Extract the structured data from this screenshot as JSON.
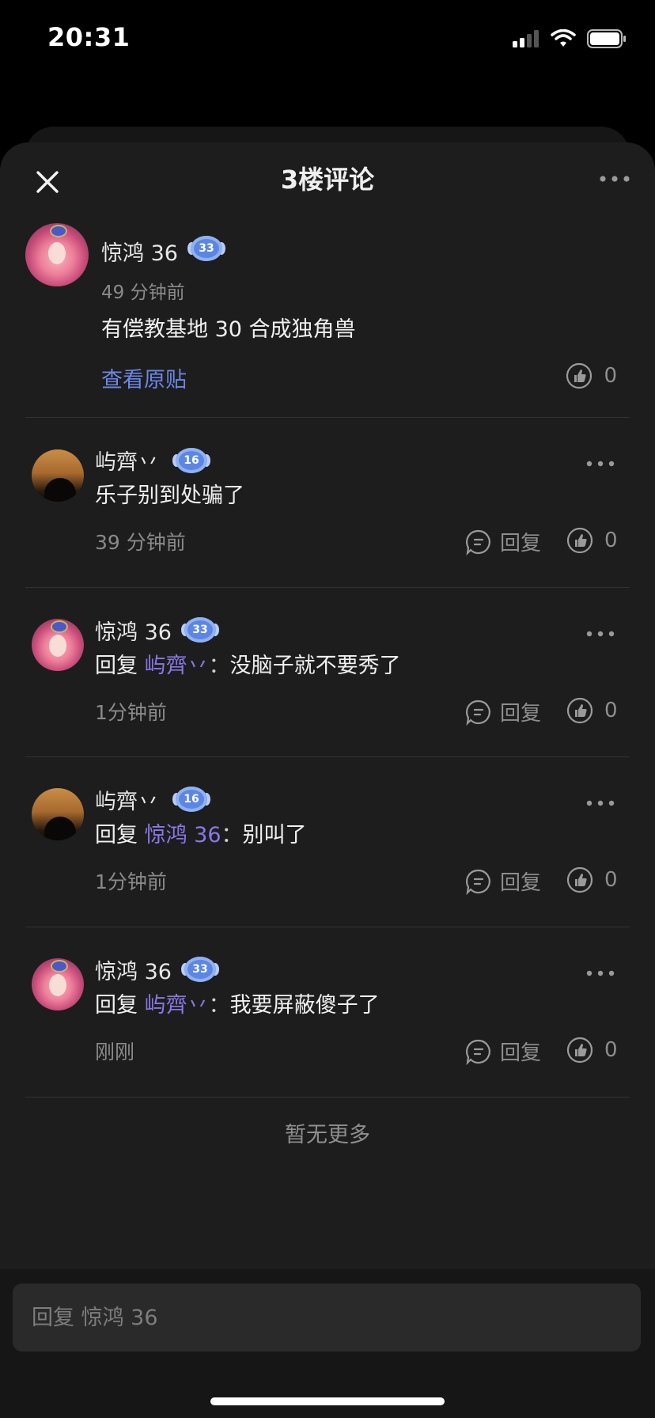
{
  "status_bar": {
    "time": "20:31"
  },
  "header": {
    "title": "3楼评论"
  },
  "original_post": {
    "author": "惊鸿 36",
    "level": "33",
    "time": "49 分钟前",
    "content": "有偿教基地 30 合成独角兽",
    "view_original_label": "查看原贴",
    "like_count": "0"
  },
  "comments": [
    {
      "author": "屿齊丷",
      "level": "16",
      "reply_label": "",
      "reply_to": "",
      "colon": "",
      "content": "乐子别到处骗了",
      "time": "39 分钟前",
      "reply_button": "回复",
      "like_count": "0"
    },
    {
      "author": "惊鸿 36",
      "level": "33",
      "reply_label": "回复",
      "reply_to": "屿齊丷",
      "colon": "：",
      "content": "没脑子就不要秀了",
      "time": "1分钟前",
      "reply_button": "回复",
      "like_count": "0"
    },
    {
      "author": "屿齊丷",
      "level": "16",
      "reply_label": "回复",
      "reply_to": "惊鸿 36",
      "colon": "：",
      "content": "别叫了",
      "time": "1分钟前",
      "reply_button": "回复",
      "like_count": "0"
    },
    {
      "author": "惊鸿 36",
      "level": "33",
      "reply_label": "回复",
      "reply_to": "屿齊丷",
      "colon": "：",
      "content": "我要屏蔽傻子了",
      "time": "刚刚",
      "reply_button": "回复",
      "like_count": "0"
    }
  ],
  "footer": {
    "no_more": "暂无更多"
  },
  "reply_input": {
    "placeholder": "回复 惊鸿 36"
  },
  "icons": {
    "close": "close-icon",
    "more": "more-dots-icon",
    "like": "thumbs-up-icon",
    "reply": "comment-bubble-icon",
    "level_badge": "level-badge-icon",
    "signal": "signal-icon",
    "wifi": "wifi-icon",
    "battery": "battery-icon"
  },
  "colors": {
    "background": "#1d1d1d",
    "link": "#6b86e8",
    "mention": "#8a78e8",
    "badge": "#5b86e5"
  }
}
